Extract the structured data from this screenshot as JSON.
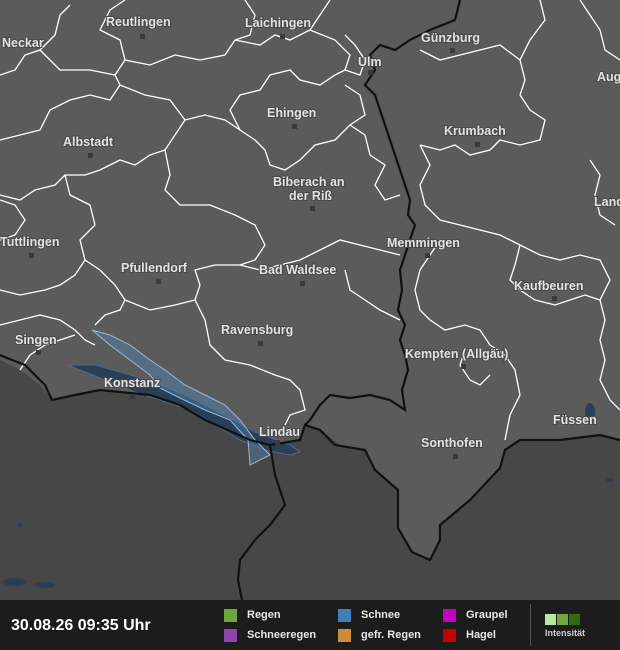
{
  "map": {
    "cities": [
      {
        "name": "Reutlingen"
      },
      {
        "name": "Laichingen"
      },
      {
        "name": "Neckar"
      },
      {
        "name": "Günzburg"
      },
      {
        "name": "Ulm"
      },
      {
        "name": "Augsburg"
      },
      {
        "name": "Ehingen"
      },
      {
        "name": "Albstadt"
      },
      {
        "name": "Krumbach"
      },
      {
        "name": "Biberach an"
      },
      {
        "name": "der Riß"
      },
      {
        "name": "Landsberg am Lech"
      },
      {
        "name": "Tuttlingen"
      },
      {
        "name": "Memmingen"
      },
      {
        "name": "Pfullendorf"
      },
      {
        "name": "Bad Waldsee"
      },
      {
        "name": "Kaufbeuren"
      },
      {
        "name": "Singen"
      },
      {
        "name": "Ravensburg"
      },
      {
        "name": "Kempten (Allgäu)"
      },
      {
        "name": "Konstanz"
      },
      {
        "name": "Füssen"
      },
      {
        "name": "Lindau"
      },
      {
        "name": "Sonthofen"
      }
    ]
  },
  "footer": {
    "timestamp": "30.08.26 09:35 Uhr",
    "legend": [
      {
        "label": "Regen",
        "color": "#6fa83a"
      },
      {
        "label": "Schneeregen",
        "color": "#8e44ad"
      },
      {
        "label": "Schnee",
        "color": "#3d7fb8"
      },
      {
        "label": "gefr. Regen",
        "color": "#d08a3a"
      },
      {
        "label": "Graupel",
        "color": "#c400c4"
      },
      {
        "label": "Hagel",
        "color": "#c40000"
      }
    ],
    "intensity_label": "Intensität",
    "intensity_colors": [
      "#b9e6a0",
      "#6fa83a",
      "#2e6b12"
    ]
  }
}
